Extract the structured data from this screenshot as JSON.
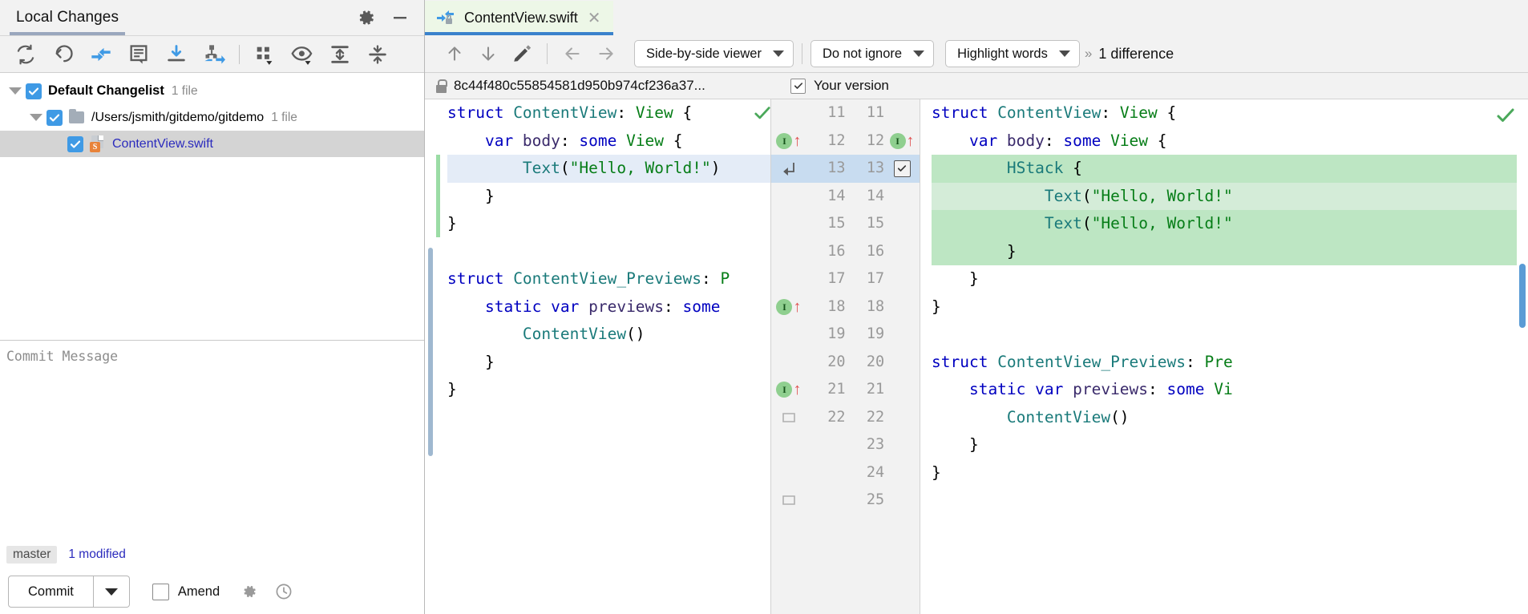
{
  "left_panel": {
    "tab_title": "Local Changes",
    "header_icons": [
      {
        "name": "gear-icon",
        "glyph": "gear"
      },
      {
        "name": "minimize-icon",
        "glyph": "minus"
      }
    ],
    "toolbar_icons": [
      {
        "name": "refresh-icon",
        "title": "Refresh"
      },
      {
        "name": "revert-icon",
        "title": "Rollback"
      },
      {
        "name": "commit-icon",
        "title": "Commit"
      },
      {
        "name": "show-diff-icon",
        "title": "Show Diff"
      },
      {
        "name": "update-icon",
        "title": "Update"
      },
      {
        "name": "shelve-icon",
        "title": "Shelve"
      },
      {
        "name": "group-by-icon",
        "title": "Group By"
      },
      {
        "name": "preview-icon",
        "title": "Preview Diff"
      },
      {
        "name": "expand-all-icon",
        "title": "Expand All"
      },
      {
        "name": "collapse-all-icon",
        "title": "Collapse All"
      }
    ],
    "tree": [
      {
        "name": "changelist-row",
        "label": "Default Changelist",
        "count": "1 file",
        "indent": 0,
        "checked": true,
        "expanded": true,
        "icon": "none",
        "selected": false
      },
      {
        "name": "folder-row",
        "label": "/Users/jsmith/gitdemo/gitdemo",
        "count": "1 file",
        "indent": 1,
        "checked": true,
        "expanded": true,
        "icon": "folder-icon",
        "selected": false
      },
      {
        "name": "file-row",
        "label": "ContentView.swift",
        "count": "",
        "indent": 2,
        "checked": true,
        "expanded": false,
        "icon": "swift-file-icon",
        "icon_badge": "S",
        "selected": true
      }
    ],
    "commit_message": {
      "value": "",
      "placeholder": "Commit Message"
    },
    "status": {
      "branch": "master",
      "modified": "1 modified"
    },
    "commit_controls": {
      "commit_label": "Commit",
      "dropdown_icon": "chevron-down-icon",
      "amend_label": "Amend",
      "amend_checked": false,
      "settings_icon": "gear-icon",
      "history_icon": "clock-icon"
    }
  },
  "diff_panel": {
    "tab": {
      "label": "ContentView.swift",
      "icon": "commit-lock-icon",
      "close_icon": "close-icon"
    },
    "toolbar": {
      "prev_diff_icon": "arrow-up-icon",
      "next_diff_icon": "arrow-down-icon",
      "edit_icon": "pencil-icon",
      "apply_left_icon": "arrow-left-icon",
      "apply_right_icon": "arrow-right-icon",
      "viewer_mode": "Side-by-side viewer",
      "whitespace_mode": "Do not ignore",
      "highlight_mode": "Highlight words",
      "overflow_icon": "chevron-double-right-icon",
      "difference_count": "1 difference"
    },
    "revisions": {
      "left_label": "8c44f480c55854581d950b974cf236a37...",
      "left_icon": "lock-icon",
      "right_label": "Your version",
      "right_checkbox": true
    },
    "left_code": [
      {
        "num": "",
        "segments": [
          {
            "t": "struct ",
            "c": "kw"
          },
          {
            "t": "ContentView",
            "c": "ty"
          },
          {
            "t": ": ",
            "c": "pl"
          },
          {
            "t": "View",
            "c": "grn"
          },
          {
            "t": " {",
            "c": "pl"
          }
        ],
        "hl": ""
      },
      {
        "num": "",
        "segments": [
          {
            "t": "    var ",
            "c": "kw"
          },
          {
            "t": "body",
            "c": "vr"
          },
          {
            "t": ": ",
            "c": "pl"
          },
          {
            "t": "some ",
            "c": "kw"
          },
          {
            "t": "View",
            "c": "grn"
          },
          {
            "t": " {",
            "c": "pl"
          }
        ],
        "hl": ""
      },
      {
        "num": "",
        "segments": [
          {
            "t": "        ",
            "c": "pl"
          },
          {
            "t": "Text",
            "c": "fn"
          },
          {
            "t": "(",
            "c": "pl"
          },
          {
            "t": "\"Hello, World!\"",
            "c": "str"
          },
          {
            "t": ")",
            "c": "pl"
          }
        ],
        "hl": "blue"
      },
      {
        "num": "",
        "segments": [
          {
            "t": "    }",
            "c": "pl"
          }
        ],
        "hl": ""
      },
      {
        "num": "",
        "segments": [
          {
            "t": "}",
            "c": "pl"
          }
        ],
        "hl": ""
      },
      {
        "num": "",
        "segments": [
          {
            "t": "",
            "c": "pl"
          }
        ],
        "hl": ""
      },
      {
        "num": "",
        "segments": [
          {
            "t": "struct ",
            "c": "kw"
          },
          {
            "t": "ContentView_Previews",
            "c": "ty"
          },
          {
            "t": ": ",
            "c": "pl"
          },
          {
            "t": "P",
            "c": "grn"
          }
        ],
        "hl": ""
      },
      {
        "num": "",
        "segments": [
          {
            "t": "    static var ",
            "c": "kw"
          },
          {
            "t": "previews",
            "c": "vr"
          },
          {
            "t": ": ",
            "c": "pl"
          },
          {
            "t": "some ",
            "c": "kw"
          }
        ],
        "hl": ""
      },
      {
        "num": "",
        "segments": [
          {
            "t": "        ",
            "c": "pl"
          },
          {
            "t": "ContentView",
            "c": "ty"
          },
          {
            "t": "()",
            "c": "pl"
          }
        ],
        "hl": ""
      },
      {
        "num": "",
        "segments": [
          {
            "t": "    }",
            "c": "pl"
          }
        ],
        "hl": ""
      },
      {
        "num": "",
        "segments": [
          {
            "t": "}",
            "c": "pl"
          }
        ],
        "hl": ""
      }
    ],
    "gutter_rows": [
      {
        "left": "11",
        "right": "11",
        "marker": "",
        "sel": false
      },
      {
        "left": "12",
        "right": "12",
        "marker": "inspect-up",
        "marker_right": "inspect-up",
        "sel": false
      },
      {
        "left": "13",
        "right": "13",
        "marker": "fold",
        "marker_right": "checkbox",
        "sel": true
      },
      {
        "left": "14",
        "right": "14",
        "marker": "",
        "sel": false
      },
      {
        "left": "15",
        "right": "15",
        "marker": "",
        "sel": false
      },
      {
        "left": "16",
        "right": "16",
        "marker": "",
        "sel": false
      },
      {
        "left": "17",
        "right": "17",
        "marker": "",
        "sel": false
      },
      {
        "left": "18",
        "right": "18",
        "marker": "inspect-up",
        "sel": false
      },
      {
        "left": "19",
        "right": "19",
        "marker": "",
        "sel": false
      },
      {
        "left": "20",
        "right": "20",
        "marker": "",
        "sel": false
      },
      {
        "left": "21",
        "right": "21",
        "marker": "inspect-up-right",
        "sel": false
      },
      {
        "left": "22",
        "right": "22",
        "marker": "collapse",
        "sel": false
      },
      {
        "left": "",
        "right": "23",
        "marker": "",
        "sel": false
      },
      {
        "left": "",
        "right": "24",
        "marker": "",
        "sel": false
      },
      {
        "left": "",
        "right": "25",
        "marker": "collapse",
        "sel": false
      }
    ],
    "right_code": [
      {
        "segments": [
          {
            "t": "struct ",
            "c": "kw"
          },
          {
            "t": "ContentView",
            "c": "ty"
          },
          {
            "t": ": ",
            "c": "pl"
          },
          {
            "t": "View",
            "c": "grn"
          },
          {
            "t": " {",
            "c": "pl"
          }
        ],
        "hl": ""
      },
      {
        "segments": [
          {
            "t": "    var ",
            "c": "kw"
          },
          {
            "t": "body",
            "c": "vr"
          },
          {
            "t": ": ",
            "c": "pl"
          },
          {
            "t": "some ",
            "c": "kw"
          },
          {
            "t": "View",
            "c": "grn"
          },
          {
            "t": " {",
            "c": "pl"
          }
        ],
        "hl": ""
      },
      {
        "segments": [
          {
            "t": "        ",
            "c": "pl"
          },
          {
            "t": "HStack",
            "c": "fn"
          },
          {
            "t": " {",
            "c": "pl"
          }
        ],
        "hl": "green"
      },
      {
        "segments": [
          {
            "t": "            ",
            "c": "pl"
          },
          {
            "t": "Text",
            "c": "fn"
          },
          {
            "t": "(",
            "c": "pl"
          },
          {
            "t": "\"Hello, World!\"",
            "c": "str"
          }
        ],
        "hl": "green-inner"
      },
      {
        "segments": [
          {
            "t": "            ",
            "c": "pl"
          },
          {
            "t": "Text",
            "c": "fn"
          },
          {
            "t": "(",
            "c": "pl"
          },
          {
            "t": "\"Hello, World!\"",
            "c": "str"
          }
        ],
        "hl": "green"
      },
      {
        "segments": [
          {
            "t": "        }",
            "c": "pl"
          }
        ],
        "hl": "green"
      },
      {
        "segments": [
          {
            "t": "    }",
            "c": "pl"
          }
        ],
        "hl": ""
      },
      {
        "segments": [
          {
            "t": "}",
            "c": "pl"
          }
        ],
        "hl": ""
      },
      {
        "segments": [
          {
            "t": "",
            "c": "pl"
          }
        ],
        "hl": ""
      },
      {
        "segments": [
          {
            "t": "struct ",
            "c": "kw"
          },
          {
            "t": "ContentView_Previews",
            "c": "ty"
          },
          {
            "t": ": ",
            "c": "pl"
          },
          {
            "t": "Pre",
            "c": "grn"
          }
        ],
        "hl": ""
      },
      {
        "segments": [
          {
            "t": "    static var ",
            "c": "kw"
          },
          {
            "t": "previews",
            "c": "vr"
          },
          {
            "t": ": ",
            "c": "pl"
          },
          {
            "t": "some ",
            "c": "kw"
          },
          {
            "t": "Vi",
            "c": "grn"
          }
        ],
        "hl": ""
      },
      {
        "segments": [
          {
            "t": "        ",
            "c": "pl"
          },
          {
            "t": "ContentView",
            "c": "ty"
          },
          {
            "t": "()",
            "c": "pl"
          }
        ],
        "hl": ""
      },
      {
        "segments": [
          {
            "t": "    }",
            "c": "pl"
          }
        ],
        "hl": ""
      },
      {
        "segments": [
          {
            "t": "}",
            "c": "pl"
          }
        ],
        "hl": ""
      }
    ]
  },
  "colors": {
    "accent_blue": "#3f9ae5",
    "tab_underline": "#3b82cc",
    "added_green": "#bde6c3",
    "selected_blue": "#e4ecf7",
    "link_blue": "#2b2bbd",
    "swift_orange": "#e8833a"
  }
}
